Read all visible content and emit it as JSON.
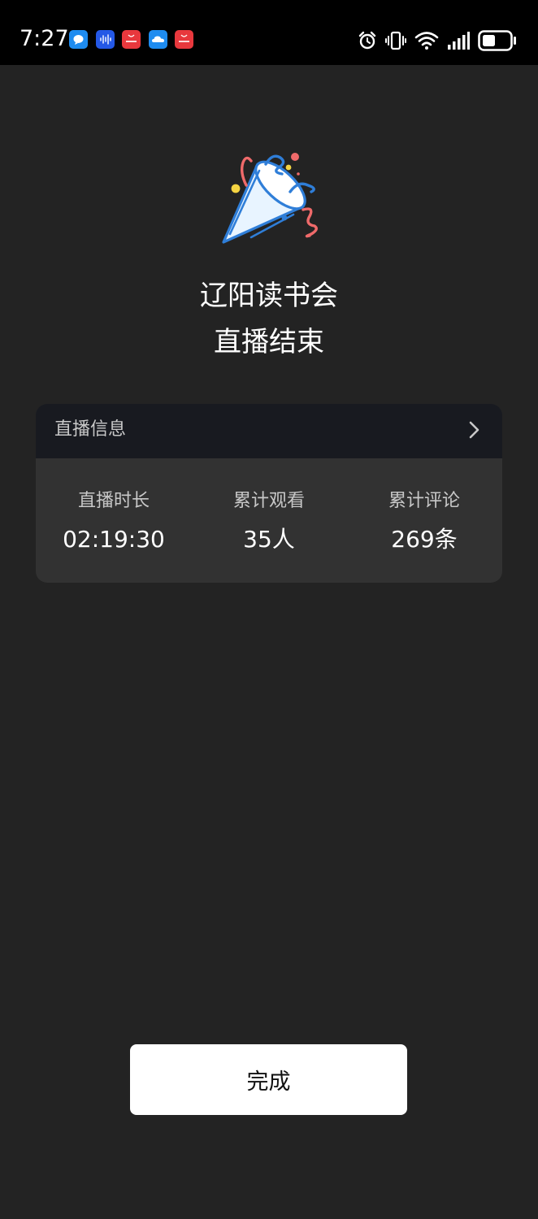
{
  "status_bar": {
    "time": "7:27",
    "notification_icons": [
      "chat-bubble-icon",
      "voice-wave-icon",
      "huawei-store-icon",
      "cloud-icon",
      "huawei-store-icon"
    ],
    "system_icons": [
      "alarm-icon",
      "vibrate-icon",
      "wifi-icon",
      "signal-icon",
      "battery-icon"
    ]
  },
  "hero": {
    "icon": "party-popper-icon",
    "title_line1": "辽阳读书会",
    "title_line2": "直播结束"
  },
  "info_card": {
    "header_label": "直播信息",
    "stats": [
      {
        "label": "直播时长",
        "value": "02:19:30"
      },
      {
        "label": "累计观看",
        "value": "35人"
      },
      {
        "label": "累计评论",
        "value": "269条"
      }
    ]
  },
  "footer": {
    "done_label": "完成"
  },
  "colors": {
    "background": "#232323",
    "status_bar": "#000000",
    "card": "#323232",
    "card_header": "#181a20",
    "button": "#ffffff"
  }
}
